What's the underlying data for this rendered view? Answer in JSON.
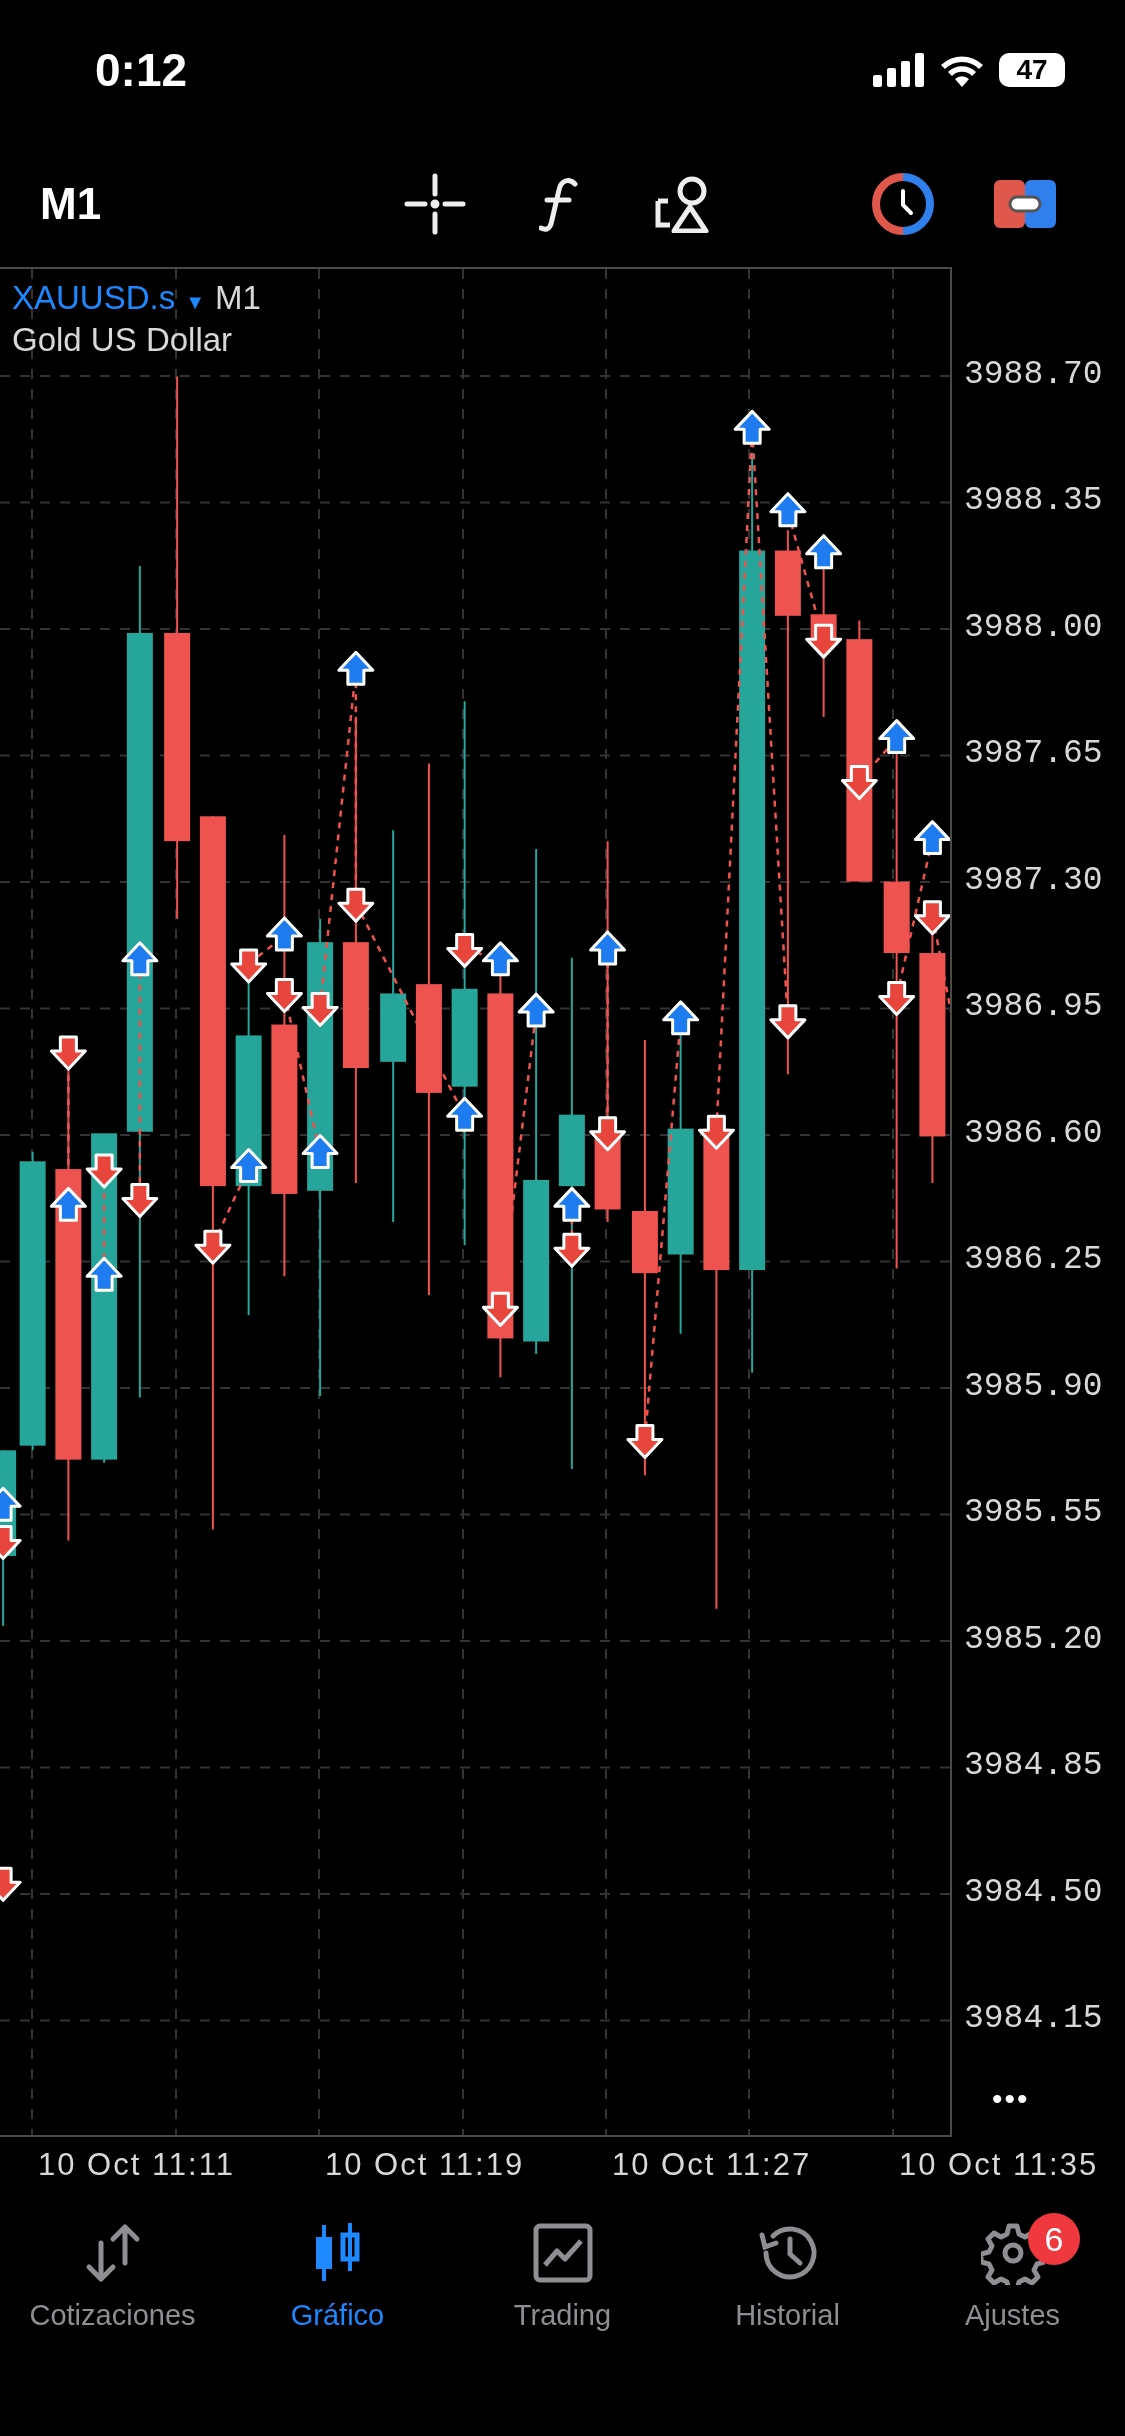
{
  "status_bar": {
    "time": "0:12",
    "battery": "47"
  },
  "toolbar": {
    "timeframe": "M1"
  },
  "chart": {
    "symbol": "XAUUSD.s",
    "symbol_marker": "▼",
    "timeframe": "M1",
    "description": "Gold US Dollar",
    "price_labels": [
      "3988.70",
      "3988.35",
      "3988.00",
      "3987.65",
      "3987.30",
      "3986.95",
      "3986.60",
      "3986.25",
      "3985.90",
      "3985.55",
      "3985.20",
      "3984.85",
      "3984.50",
      "3984.15"
    ],
    "more": "•••",
    "time_labels": [
      "10 Oct 11:11",
      "10 Oct 11:19",
      "10 Oct 11:27",
      "10 Oct 11:35"
    ]
  },
  "tabs": [
    {
      "label": "Cotizaciones",
      "kind": "quotes",
      "selected": false
    },
    {
      "label": "Gráfico",
      "kind": "chart",
      "selected": true
    },
    {
      "label": "Trading",
      "kind": "trading",
      "selected": false
    },
    {
      "label": "Historial",
      "kind": "history",
      "selected": false
    },
    {
      "label": "Ajustes",
      "kind": "settings",
      "selected": false,
      "badge": "6"
    }
  ]
}
